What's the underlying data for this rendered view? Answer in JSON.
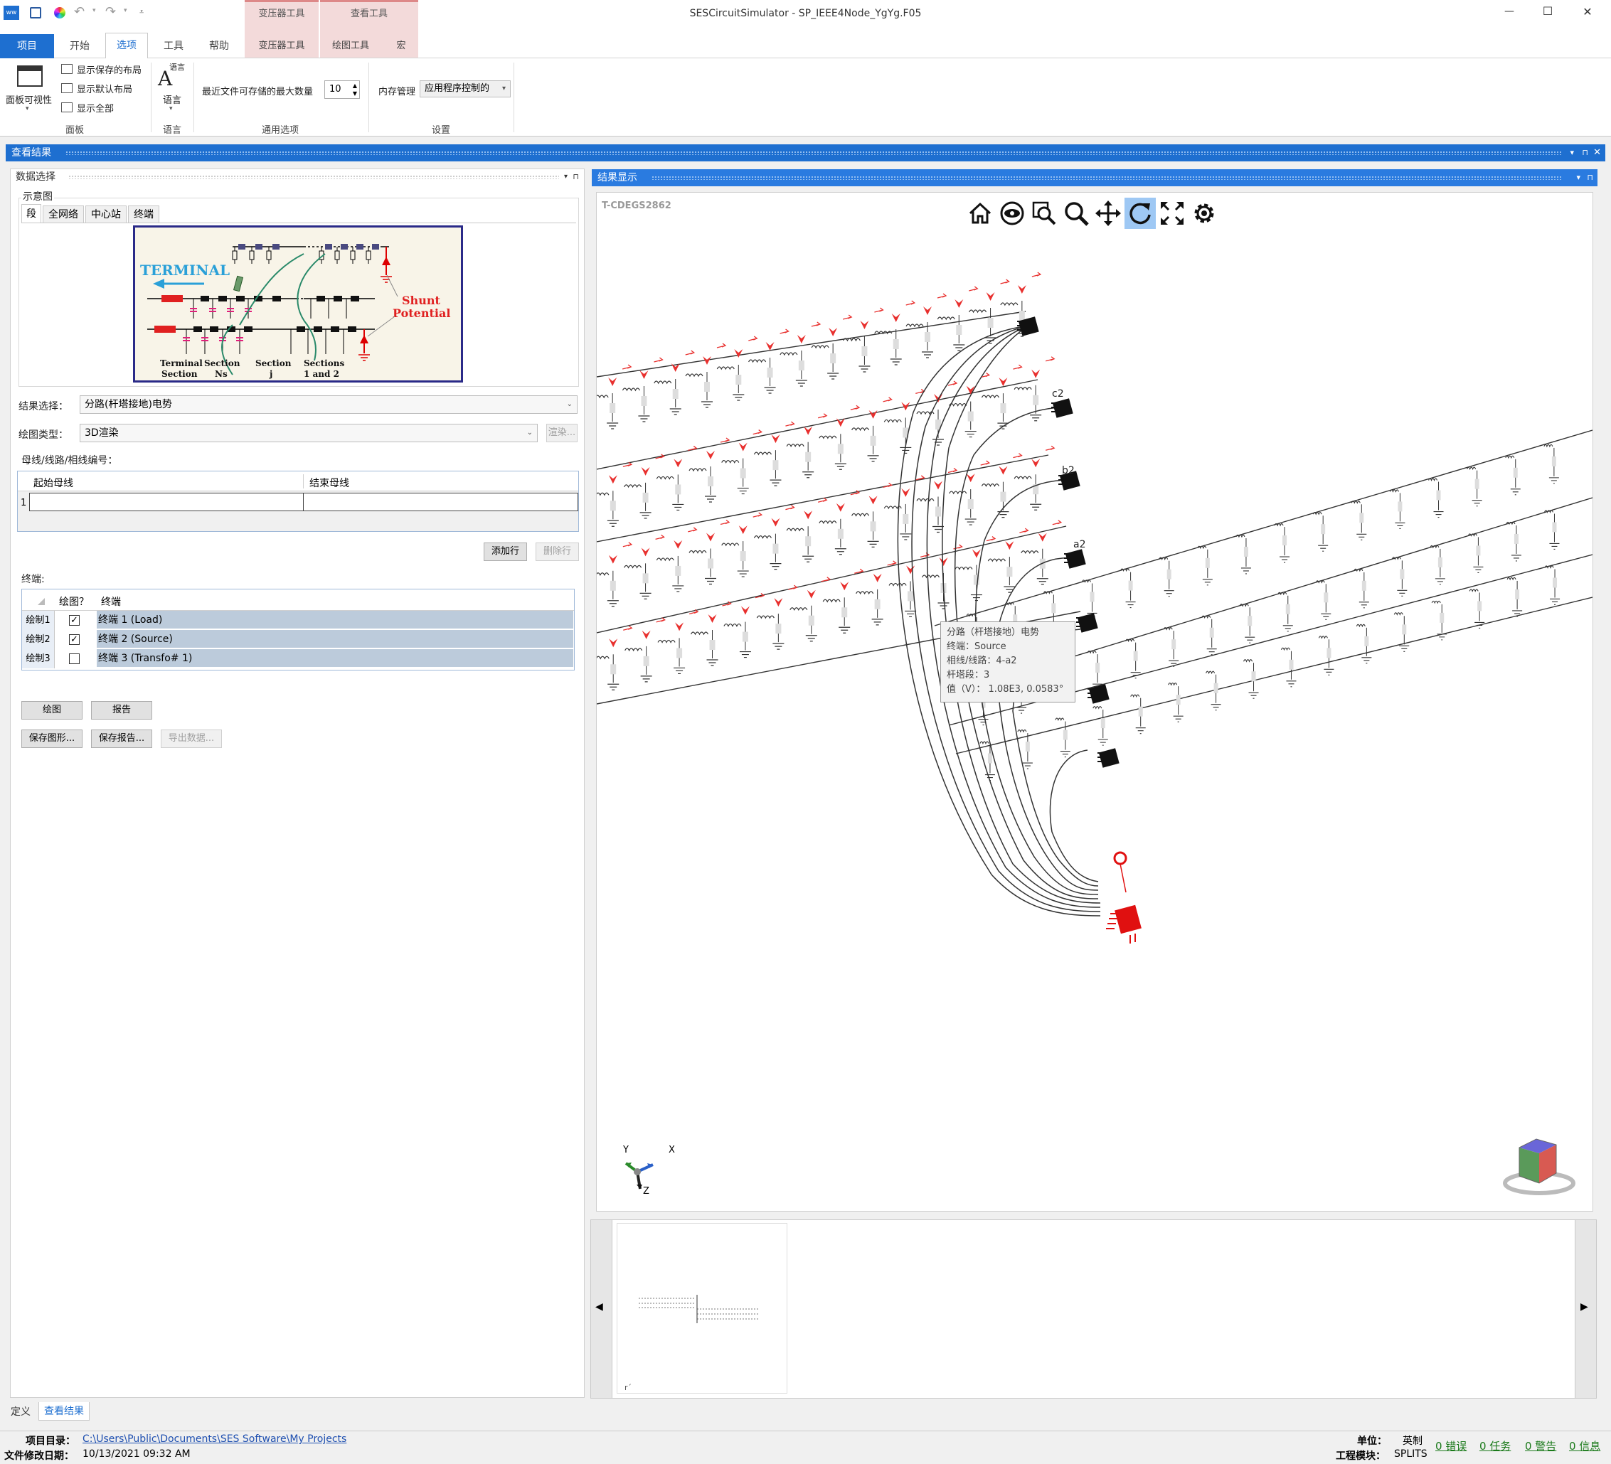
{
  "window": {
    "title": "SESCircuitSimulator - SP_IEEE4Node_YgYg.F05",
    "minimize": "—",
    "maximize": "☐",
    "close": "✕"
  },
  "ribbon": {
    "tabs": [
      "项目",
      "开始",
      "选项",
      "工具",
      "帮助",
      "变压器工具",
      "绘图工具",
      "宏"
    ],
    "context_groups": [
      "变压器工具",
      "查看工具"
    ],
    "panel_group": {
      "title": "面板",
      "panel_visibility": "面板可视性",
      "show_saved_layout": "显示保存的布局",
      "show_default_layout": "显示默认布局",
      "show_all": "显示全部"
    },
    "language_group": {
      "title": "语言",
      "button": "语言"
    },
    "general_group": {
      "title": "通用选项",
      "recent_label": "最近文件可存储的最大数量",
      "recent_value": "10"
    },
    "settings_group": {
      "title": "设置",
      "memory_label": "内存管理",
      "memory_value": "应用程序控制的"
    }
  },
  "view_results": {
    "header": "查看结果"
  },
  "data_selection": {
    "header": "数据选择",
    "schematic_label": "示意图",
    "schematic_tabs": [
      "段",
      "全网络",
      "中心站",
      "终端"
    ],
    "diagram": {
      "terminal": "TERMINAL",
      "shunt": "Shunt",
      "potential": "Potential",
      "labels": [
        "Terminal",
        "Section",
        "Section",
        "Ns",
        "Section",
        "j",
        "Sections",
        "1 and 2"
      ]
    },
    "result_select_label": "结果选择：",
    "result_select_value": "分路(杆塔接地)电势",
    "plot_type_label": "绘图类型：",
    "plot_type_value": "3D渲染",
    "render_button": "渲染...",
    "bus_label": "母线/线路/相线编号：",
    "bus_table": {
      "columns": [
        "起始母线",
        "结束母线"
      ],
      "rows": [
        {
          "index": "1",
          "start": "",
          "end": ""
        }
      ]
    },
    "add_row": "添加行",
    "delete_row": "删除行",
    "terminals_label": "终端:",
    "terminal_table": {
      "columns": [
        "绘图？",
        "终端"
      ],
      "rows": [
        {
          "row_label": "绘制1",
          "checked": true,
          "name": "终端 1 (Load)"
        },
        {
          "row_label": "绘制2",
          "checked": true,
          "name": "终端 2 (Source)"
        },
        {
          "row_label": "绘制3",
          "checked": false,
          "name": "终端 3 (Transfo#  1)"
        }
      ]
    },
    "plot_button": "绘图",
    "report_button": "报告",
    "save_figure_button": "保存图形...",
    "save_report_button": "保存报告...",
    "export_data_button": "导出数据..."
  },
  "results_display": {
    "header": "结果显示",
    "watermark": "T-CDEGS2862",
    "toolbar_icons": [
      "home-icon",
      "eye-icon",
      "zoom-window-icon",
      "zoom-icon",
      "pan-icon",
      "rotate-icon",
      "fit-screen-icon",
      "settings-gear-icon"
    ],
    "node_labels": [
      "c2",
      "b2",
      "a2"
    ],
    "tooltip": {
      "line1": "分路（杆塔接地）电势",
      "line2": "终端：Source",
      "line3": "相线/线路：4-a2",
      "line4": "杆塔段：3",
      "line5": "值（V）： 1.08E3, 0.0583°"
    },
    "axes": {
      "x": "X",
      "y": "Y",
      "z": "Z"
    },
    "thumbnail_label": "r´"
  },
  "bottom_tabs": [
    "定义",
    "查看结果"
  ],
  "status": {
    "project_dir_label": "项目目录：",
    "project_dir": "C:\\Users\\Public\\Documents\\SES Software\\My Projects",
    "modified_label": "文件修改日期：",
    "modified": "10/13/2021 09:32 AM",
    "units_label": "单位：",
    "units": "英制",
    "module_label": "工程模块：",
    "module": "SPLITS",
    "errors": "0 错误",
    "tasks": "0 任务",
    "warnings": "0 警告",
    "info": "0 信息"
  },
  "colors": {
    "accent": "#1e6fd0",
    "context_tab": "#f3dada",
    "marker_red": "#e8302e",
    "terminal_red": "#e01010"
  }
}
